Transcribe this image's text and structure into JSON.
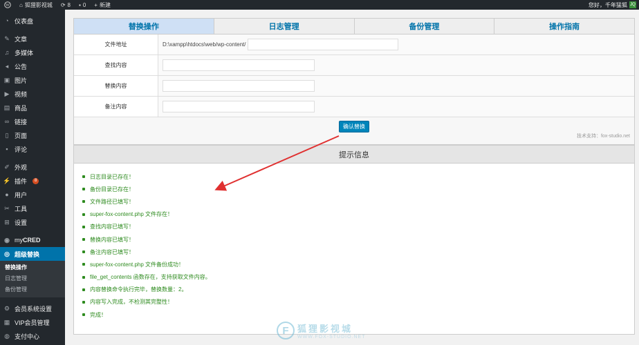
{
  "adminbar": {
    "site_name": "狐狸影视城",
    "updates_count": "8",
    "comments_count": "0",
    "new_label": "新建",
    "greeting": "您好，千年猛狐",
    "avatar_text": "JQ"
  },
  "sidebar": {
    "items": [
      {
        "label": "仪表盘",
        "icon": "dashboard-icon"
      },
      {
        "label": "文章",
        "icon": "pin-icon"
      },
      {
        "label": "多媒体",
        "icon": "media-icon"
      },
      {
        "label": "公告",
        "icon": "megaphone-icon"
      },
      {
        "label": "图片",
        "icon": "image-icon"
      },
      {
        "label": "视频",
        "icon": "video-icon"
      },
      {
        "label": "商品",
        "icon": "cart-icon"
      },
      {
        "label": "链接",
        "icon": "link-icon"
      },
      {
        "label": "页面",
        "icon": "page-icon"
      },
      {
        "label": "评论",
        "icon": "comment-icon"
      },
      {
        "label": "外观",
        "icon": "brush-icon"
      },
      {
        "label": "插件",
        "icon": "plugin-icon",
        "badge": "8"
      },
      {
        "label": "用户",
        "icon": "user-icon"
      },
      {
        "label": "工具",
        "icon": "wrench-icon"
      },
      {
        "label": "设置",
        "icon": "settings-icon"
      },
      {
        "label_prefix": "my",
        "label": "CRED",
        "icon": "mycred-icon"
      },
      {
        "label": "超级替换",
        "icon": "eye-icon"
      }
    ],
    "submenu": [
      "替换操作",
      "日志管理",
      "备份管理"
    ],
    "bottom_items": [
      {
        "label": "会员系统设置",
        "icon": "gear-icon"
      },
      {
        "label": "VIP会员管理",
        "icon": "vip-icon"
      },
      {
        "label": "支付中心",
        "icon": "pay-icon"
      }
    ]
  },
  "tabs": [
    "替换操作",
    "日志管理",
    "备份管理",
    "操作指南"
  ],
  "form": {
    "file_label": "文件地址",
    "file_path_prefix": "D:\\xampp\\htdocs\\web/wp-content/",
    "file_input_value": "",
    "find_label": "查找内容",
    "find_value": "",
    "replace_label": "替换内容",
    "replace_value": "",
    "note_label": "备注内容",
    "note_value": "",
    "submit_label": "确认替换",
    "credit": "技术支持：fox-studio.net"
  },
  "hints": {
    "title": "提示信息",
    "color": "#2e8b1f",
    "items": [
      "日志目录已存在！",
      "备份目录已存在！",
      "文件路径已填写！",
      "super-fox-content.php 文件存在！",
      "查找内容已填写！",
      "替换内容已填写！",
      "备注内容已填写！",
      "super-fox-content.php 文件备份成功！",
      "file_get_contents 函数存在，支持获取文件内容。",
      "内容替换命令执行完毕，替换数量：2。",
      "内容写入完成，不检测其完整性！",
      "完成！"
    ]
  },
  "watermark": {
    "letter": "F",
    "cn": "狐狸影视城",
    "url": "WWW.FOX-STUDIO.NET"
  },
  "colors": {
    "accent": "#0073aa",
    "sidebar_bg": "#23282d",
    "arrow": "#e03030"
  }
}
